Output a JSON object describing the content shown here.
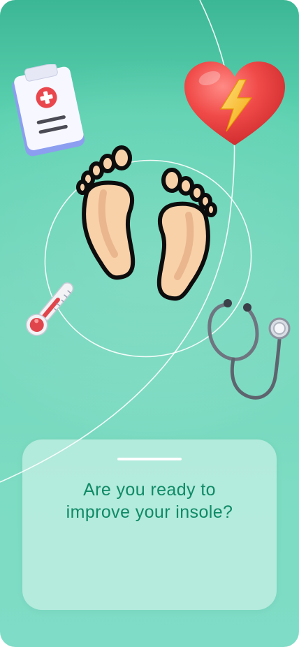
{
  "onboarding": {
    "headline_line1": "Are you ready to",
    "headline_line2": "improve your insole?"
  },
  "illustrations": {
    "clipboard": "medical-clipboard-icon",
    "heart": "heart-lightning-icon",
    "feet": "bare-feet-icon",
    "thermometer": "thermometer-icon",
    "stethoscope": "stethoscope-icon"
  },
  "colors": {
    "background_top": "#3cb795",
    "background_bottom": "#7fdcc6",
    "headline": "#0f8a66",
    "card": "rgba(255,255,255,0.42)"
  }
}
